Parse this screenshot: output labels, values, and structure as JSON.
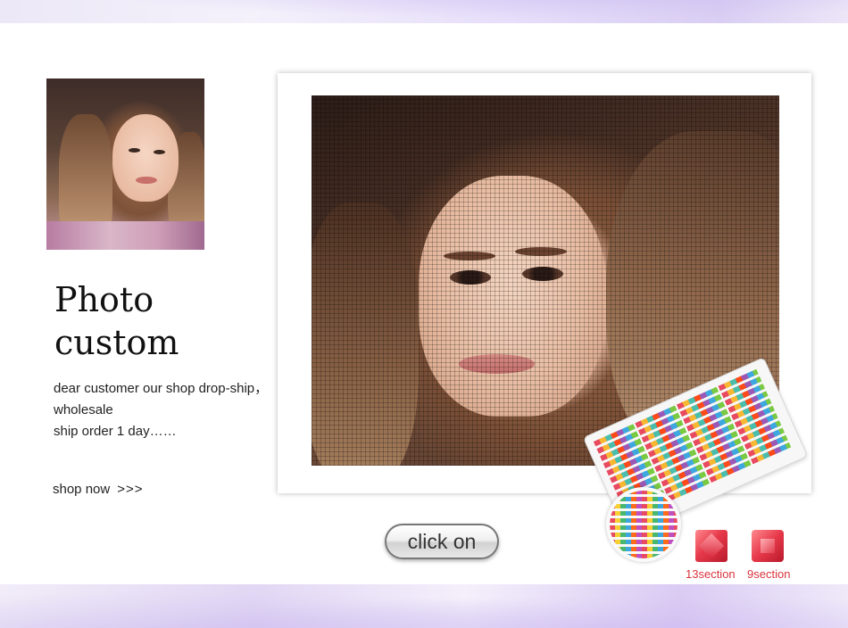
{
  "hero": {
    "title_line1": "Photo",
    "title_line2": "custom",
    "desc_line1": "dear customer our shop drop-ship，",
    "desc_line2": "wholesale",
    "desc_line3": "ship order 1 day……",
    "shop_link_label": "shop now",
    "shop_link_arrows": ">>>"
  },
  "button": {
    "label": "click on"
  },
  "drills": {
    "square_label": "13section",
    "round_label": "9section"
  },
  "colors": {
    "accent_red": "#d9343e",
    "text": "#222222"
  }
}
